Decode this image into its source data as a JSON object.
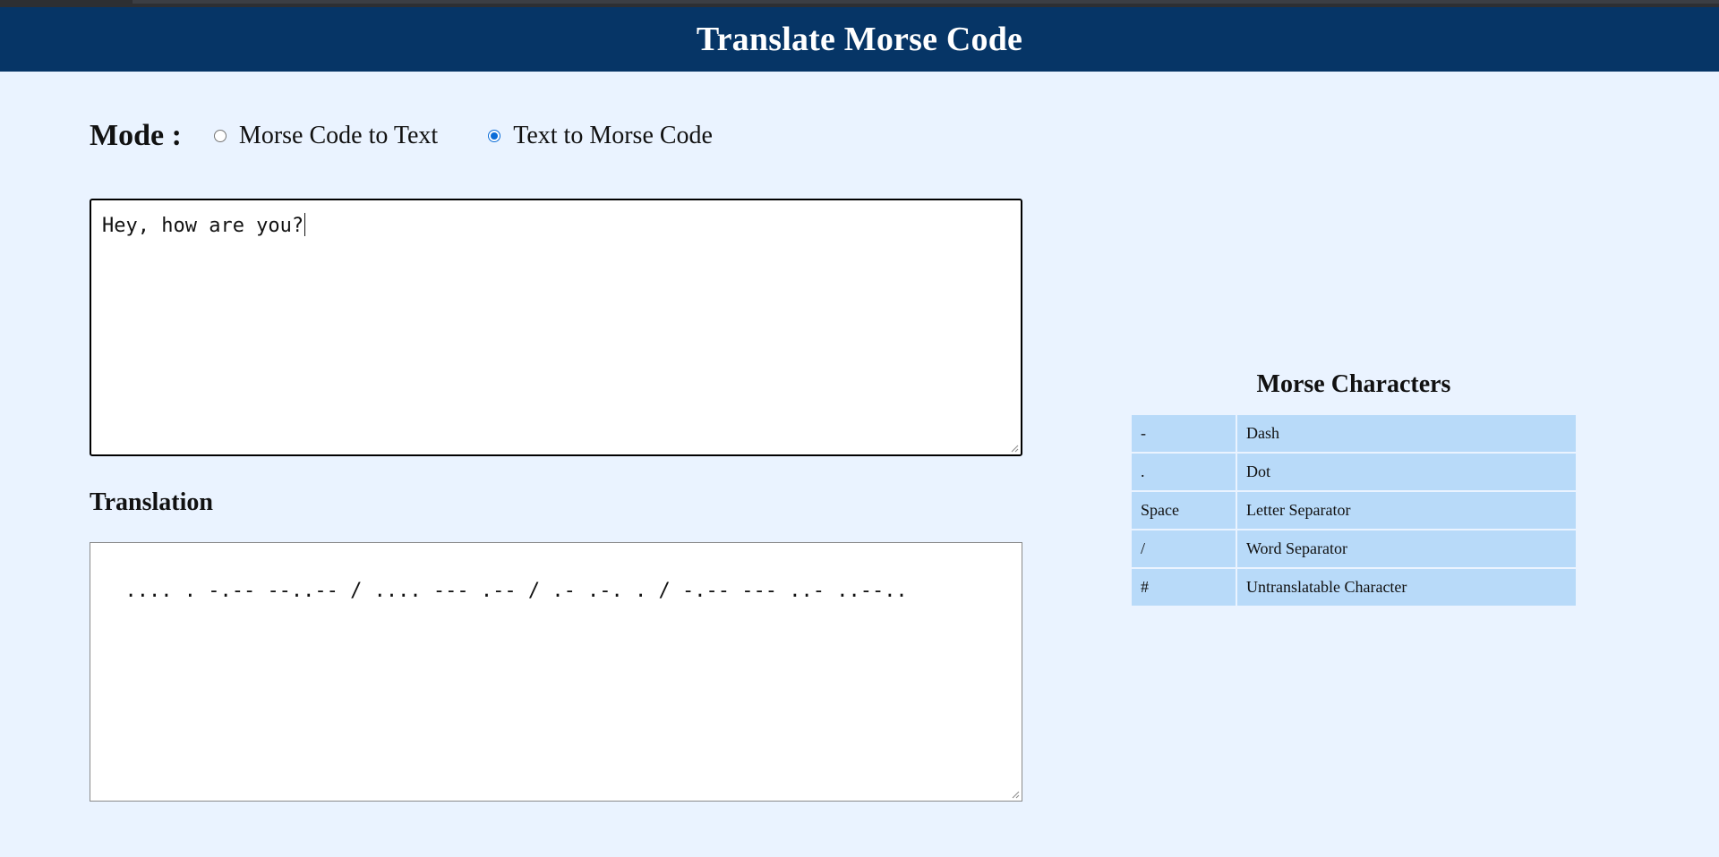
{
  "header": {
    "title": "Translate Morse Code"
  },
  "mode": {
    "label": "Mode :",
    "options": [
      {
        "label": "Morse Code to Text",
        "checked": false
      },
      {
        "label": "Text to Morse Code",
        "checked": true
      }
    ]
  },
  "input": {
    "value": "Hey, how are you?"
  },
  "translation": {
    "title": "Translation",
    "value": ".... . -.-- --..-- / .... --- .-- / .- .-. . / -.-- --- ..- ..--.."
  },
  "reference": {
    "title": "Morse Characters",
    "rows": [
      {
        "symbol": "-",
        "meaning": "Dash"
      },
      {
        "symbol": ".",
        "meaning": "Dot"
      },
      {
        "symbol": "Space",
        "meaning": "Letter Separator"
      },
      {
        "symbol": "/",
        "meaning": "Word Separator"
      },
      {
        "symbol": "#",
        "meaning": "Untranslatable Character"
      }
    ]
  },
  "colors": {
    "header_bg": "#063566",
    "page_bg": "#eaf3ff",
    "table_cell_bg": "#b8daf9",
    "radio_accent": "#0a6cd8"
  }
}
